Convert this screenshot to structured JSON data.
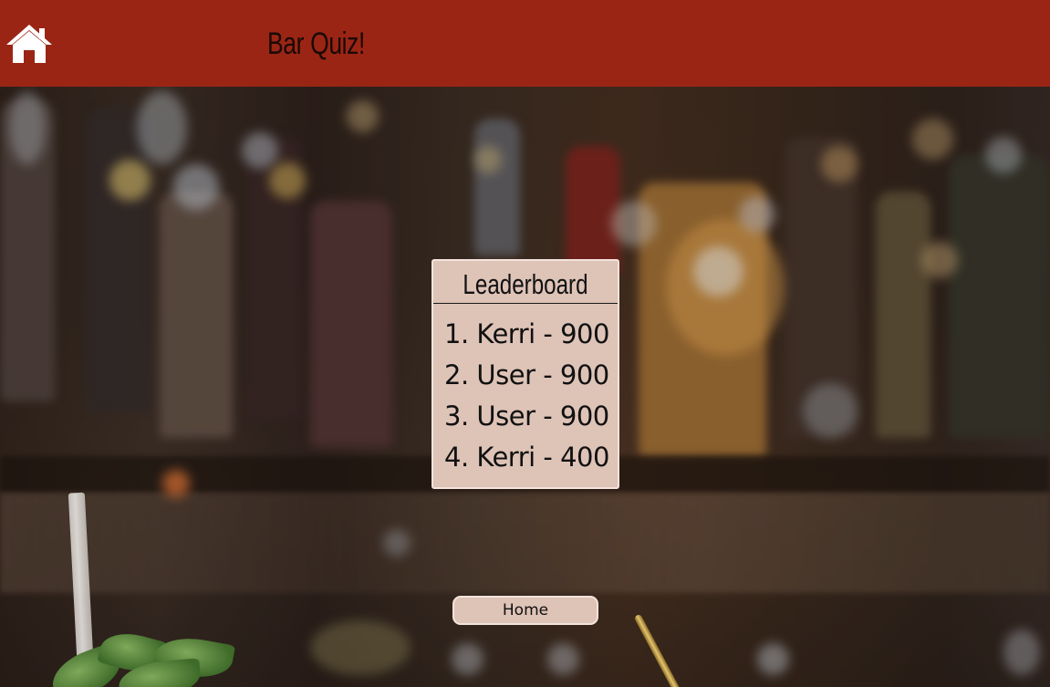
{
  "header": {
    "title": "Bar Quiz!",
    "home_icon": "home-icon",
    "background_color": "#9b2515"
  },
  "leaderboard": {
    "title": "Leaderboard",
    "entries": [
      "1. Kerri - 900",
      "2. User - 900",
      "3. User - 900",
      "4. Kerri - 400"
    ],
    "panel_color": "#dec3b7"
  },
  "footer": {
    "home_button_label": "Home"
  }
}
